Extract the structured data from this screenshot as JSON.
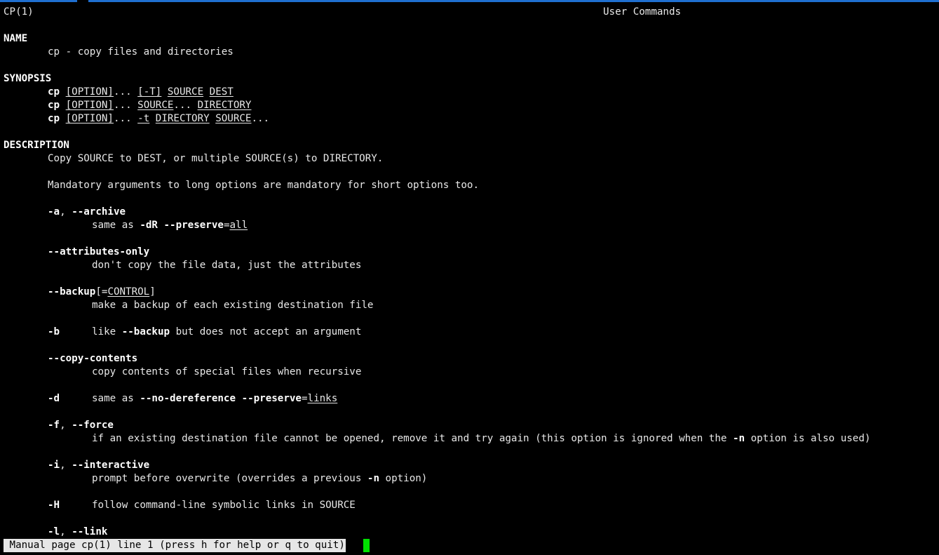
{
  "header": {
    "left": "CP(1)",
    "center": "User Commands"
  },
  "sections": {
    "name": "NAME",
    "synopsis": "SYNOPSIS",
    "description": "DESCRIPTION"
  },
  "name_line": "cp - copy files and directories",
  "synopsis": [
    {
      "cmd": "cp",
      "opt": "[OPTION]",
      "rest1": "... ",
      "a": "[-T]",
      "b": "SOURCE",
      "c": "DEST"
    },
    {
      "cmd": "cp",
      "opt": "[OPTION]",
      "rest1": "... ",
      "a": "SOURCE",
      "b": "...",
      "c": "DIRECTORY"
    },
    {
      "cmd": "cp",
      "opt": "[OPTION]",
      "rest1": "... ",
      "a": "-t",
      "b": "DIRECTORY",
      "c": "SOURCE",
      "d": "..."
    }
  ],
  "description": {
    "line1": "Copy SOURCE to DEST, or multiple SOURCE(s) to DIRECTORY.",
    "line2": "Mandatory arguments to long options are mandatory for short options too."
  },
  "options": {
    "archive": {
      "flag_a": "-a",
      "sep": ", ",
      "flag_b": "--archive",
      "desc_pre": "same as ",
      "desc_b1": "-dR",
      "desc_mid": " ",
      "desc_b2": "--preserve",
      "desc_eq": "=",
      "desc_u": "all"
    },
    "attributes_only": {
      "flag": "--attributes-only",
      "desc": "don't copy the file data, just the attributes"
    },
    "backup": {
      "flag": "--backup",
      "br1": "[=",
      "arg": "CONTROL",
      "br2": "]",
      "desc": "make a backup of each existing destination file"
    },
    "b": {
      "flag": "-b",
      "desc_pre": "like ",
      "desc_b": "--backup",
      "desc_post": " but does not accept an argument"
    },
    "copy_contents": {
      "flag": "--copy-contents",
      "desc": "copy contents of special files when recursive"
    },
    "d": {
      "flag": "-d",
      "desc_pre": "same as ",
      "desc_b1": "--no-dereference",
      "desc_mid": " ",
      "desc_b2": "--preserve",
      "desc_eq": "=",
      "desc_u": "links"
    },
    "force": {
      "flag_a": "-f",
      "sep": ", ",
      "flag_b": "--force",
      "desc_pre": "if an existing destination file cannot be opened, remove it and try again (this option is ignored when the ",
      "desc_b": "-n",
      "desc_post": " option is also used)"
    },
    "interactive": {
      "flag_a": "-i",
      "sep": ", ",
      "flag_b": "--interactive",
      "desc_pre": "prompt before overwrite (overrides a previous ",
      "desc_b": "-n",
      "desc_post": " option)"
    },
    "H": {
      "flag": "-H",
      "desc": "follow command-line symbolic links in SOURCE"
    },
    "link": {
      "flag_a": "-l",
      "sep": ", ",
      "flag_b": "--link"
    }
  },
  "status_bar": " Manual page cp(1) line 1 (press h for help or q to quit)",
  "colors": {
    "background": "#000000",
    "text": "#e8e8e8",
    "status_bg": "#e6e6e6",
    "cursor": "#00e000",
    "top_border": "#1f6fd0"
  }
}
